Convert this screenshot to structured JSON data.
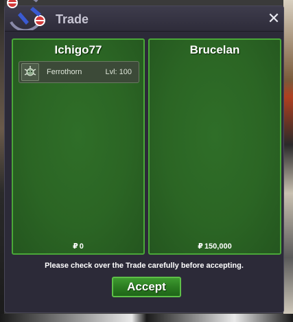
{
  "window": {
    "title": "Trade",
    "close_label": "✕"
  },
  "left_panel": {
    "player_name": "Ichigo77",
    "currency_symbol": "₽",
    "money": "0",
    "items": [
      {
        "name": "Ferrothorn",
        "level": "Lvl: 100",
        "icon": "ferrothorn-icon"
      }
    ]
  },
  "right_panel": {
    "player_name": "Brucelan",
    "currency_symbol": "₽",
    "money": "150,000"
  },
  "notice": "Please check over the Trade carefully before accepting.",
  "accept_label": "Accept",
  "colors": {
    "panel_green": "#2b6524",
    "panel_border": "#4aa838",
    "window_bg": "#2c2a38",
    "accent_red": "#d23a3a",
    "accent_blue": "#3a5ad2"
  }
}
